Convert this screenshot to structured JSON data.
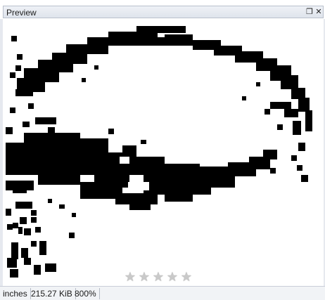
{
  "panel": {
    "title": "Preview",
    "restore_icon": "restore-window-icon",
    "close_icon": "close-icon"
  },
  "rating": {
    "value": 0,
    "max": 5,
    "star_icon": "star-icon"
  },
  "status": {
    "units": "inches",
    "file_size": "215.27 KiB",
    "zoom": "800%"
  }
}
